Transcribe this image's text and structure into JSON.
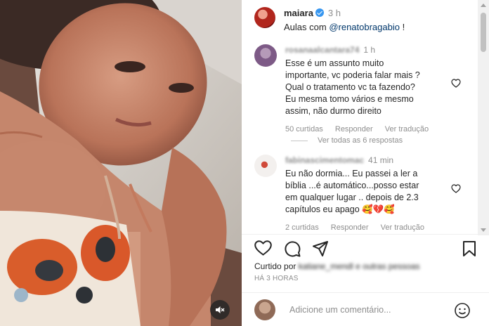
{
  "post": {
    "username": "maiara",
    "time": "3 h",
    "caption_prefix": "Aulas com ",
    "caption_mention": "@renatobragabio",
    "caption_suffix": " !"
  },
  "comments": [
    {
      "username": "rosanaalcantara74",
      "time": "1 h",
      "lines": [
        "Esse é um assunto muito",
        "importante, vc poderia falar mais ?",
        "Qual o tratamento vc ta fazendo?",
        "Eu mesma tomo vários e mesmo",
        "assim, não durmo direito"
      ],
      "likes": "50 curtidas",
      "reply": "Responder",
      "translate": "Ver tradução"
    },
    {
      "username": "fabinascimentomac",
      "time": "41 min",
      "lines": [
        "Eu não dormia... Eu passei a ler a",
        "bíblia ...é automático...posso estar",
        "em qualquer lugar .. depois de 2.3",
        "capítulos eu apago 🥰💔🥰"
      ],
      "likes": "2 curtidas",
      "reply": "Responder",
      "translate": "Ver tradução"
    }
  ],
  "view_replies": "Ver todas as 6 respostas",
  "liked_by": {
    "prefix": "Curtido por",
    "blurred": "katiane_mendl e outras pessoas"
  },
  "time_ago": "HÁ 3 HORAS",
  "add_comment": {
    "placeholder": "Adicione um comentário..."
  },
  "icons": {
    "verified": "verified-badge-icon",
    "heart": "heart-icon",
    "comment": "comment-icon",
    "share": "share-icon",
    "bookmark": "bookmark-icon",
    "emoji": "emoji-icon",
    "mute": "muted-speaker-icon"
  },
  "colors": {
    "verified": "#3897f0",
    "mention": "#00376b",
    "muted_text": "#8e8e8e"
  }
}
